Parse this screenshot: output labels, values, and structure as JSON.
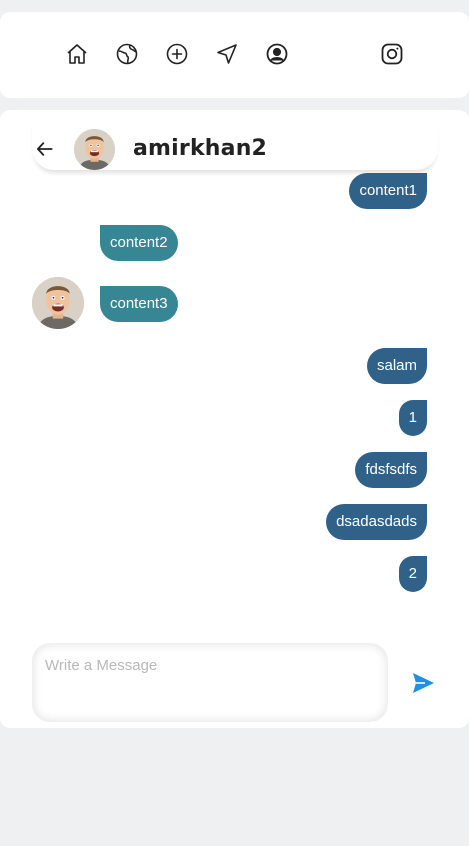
{
  "nav": {
    "icons": [
      "home-icon",
      "globe-icon",
      "plus-circle-icon",
      "navigation-icon",
      "user-circle-icon",
      "instagram-icon"
    ]
  },
  "chat": {
    "username": "amirkhan2",
    "messages": [
      {
        "text": "content1",
        "direction": "out"
      },
      {
        "text": "content2",
        "direction": "in"
      },
      {
        "text": "content3",
        "direction": "in"
      },
      {
        "text": "salam",
        "direction": "out"
      },
      {
        "text": "1",
        "direction": "out"
      },
      {
        "text": "fdsfsdfs",
        "direction": "out"
      },
      {
        "text": "dsadasdads",
        "direction": "out"
      },
      {
        "text": "2",
        "direction": "out"
      }
    ]
  },
  "composer": {
    "placeholder": "Write a Message",
    "value": ""
  },
  "colors": {
    "outgoing_bubble": "#2f6189",
    "incoming_bubble": "#368694",
    "send_icon": "#1e90e6",
    "background": "#eff0f2"
  }
}
